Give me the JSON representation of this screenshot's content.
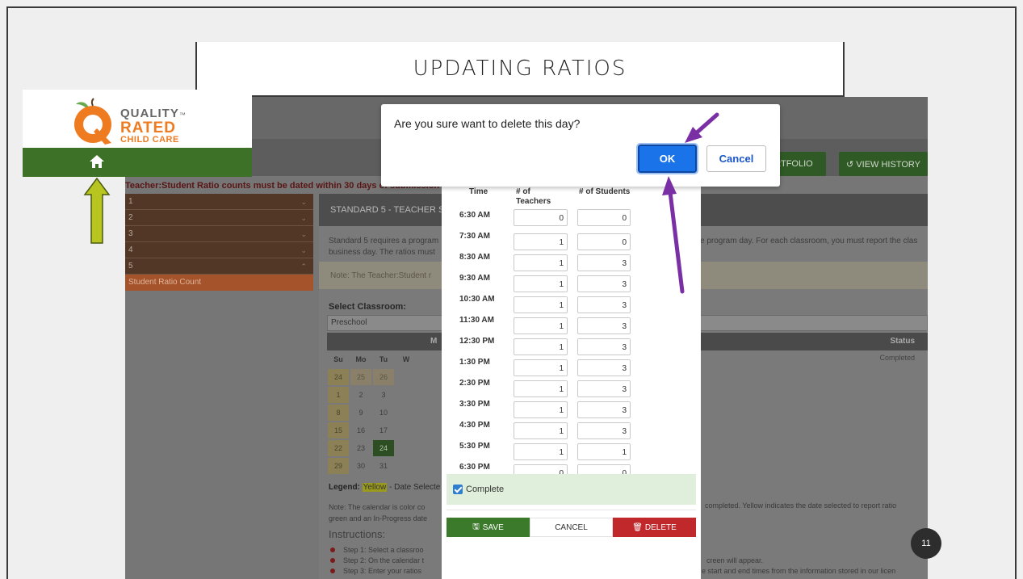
{
  "slide": {
    "title": "UPDATING RATIOS",
    "page_number": "11"
  },
  "logo": {
    "line1": "QUALITY",
    "tm": "™",
    "line2": "RATED",
    "line3": "CHILD CARE",
    "home_icon": "home-icon",
    "colors": {
      "orange": "#ef7b21",
      "green": "#3e7128"
    }
  },
  "background_app": {
    "header_buttons": [
      "RTFOLIO",
      "↺ VIEW HISTORY"
    ],
    "ratio_warning": "Teacher:Student Ratio counts must be dated within 30 days of submission of yo",
    "nav_items": [
      "1",
      "2",
      "3",
      "4",
      "5"
    ],
    "nav_sub_item": "Student Ratio Count",
    "standard_header": "STANDARD 5 - TEACHER S",
    "standard_text_left": "Standard 5 requires a program",
    "standard_text_left2": "business day. The ratios must",
    "standard_text_right": "e program day. For each classroom, you must report the clas",
    "note_text": "Note: The Teacher:Student r",
    "select_classroom_label": "Select Classroom:",
    "classroom_value": "Preschool",
    "calendar_month_initial": "M",
    "status_header": "Status",
    "status_value": "Completed",
    "calendar": {
      "weekdays": [
        "Su",
        "Mo",
        "Tu",
        "W"
      ],
      "rows": [
        [
          "24",
          "25",
          "26"
        ],
        [
          "1",
          "2",
          "3"
        ],
        [
          "8",
          "9",
          "10"
        ],
        [
          "15",
          "16",
          "17"
        ],
        [
          "22",
          "23",
          "24"
        ],
        [
          "29",
          "30",
          "31"
        ]
      ],
      "selected_date": "24"
    },
    "legend_label": "Legend:",
    "legend_yellow": "Yellow",
    "legend_rest": "- Date Selecte",
    "note2_left": "Note: The calendar is color co",
    "note2_left2": "green and an In-Progress date",
    "note2_right": "completed. Yellow indicates the date selected to report ratio",
    "instructions_title": "Instructions:",
    "steps": [
      "Step 1: Select a classroo",
      "Step 2: On the calendar t",
      "Step 3: Enter your ratios"
    ],
    "steps_right": [
      "creen will appear.",
      "e start and end times from the information stored in our licen"
    ]
  },
  "ratio_modal": {
    "col_time": "Time",
    "col_teachers_1": "# of",
    "col_teachers_2": "Teachers",
    "col_students": "# of Students",
    "rows": [
      {
        "time": "6:30 AM",
        "teachers": "0",
        "students": "0"
      },
      {
        "time": "7:30 AM",
        "teachers": "1",
        "students": "0"
      },
      {
        "time": "8:30 AM",
        "teachers": "1",
        "students": "3"
      },
      {
        "time": "9:30 AM",
        "teachers": "1",
        "students": "3"
      },
      {
        "time": "10:30 AM",
        "teachers": "1",
        "students": "3"
      },
      {
        "time": "11:30 AM",
        "teachers": "1",
        "students": "3"
      },
      {
        "time": "12:30 PM",
        "teachers": "1",
        "students": "3"
      },
      {
        "time": "1:30 PM",
        "teachers": "1",
        "students": "3"
      },
      {
        "time": "2:30 PM",
        "teachers": "1",
        "students": "3"
      },
      {
        "time": "3:30 PM",
        "teachers": "1",
        "students": "3"
      },
      {
        "time": "4:30 PM",
        "teachers": "1",
        "students": "3"
      },
      {
        "time": "5:30 PM",
        "teachers": "1",
        "students": "1"
      },
      {
        "time": "6:30 PM",
        "teachers": "0",
        "students": "0"
      }
    ],
    "complete_label": "Complete",
    "complete_checked": true,
    "save_label": "SAVE",
    "cancel_label": "CANCEL",
    "delete_label": "DELETE"
  },
  "confirm_dialog": {
    "message": "Are you sure want to delete this day?",
    "ok_label": "OK",
    "cancel_label": "Cancel"
  },
  "annotations": {
    "arrow_green_color": "#a8b619",
    "arrow_purple_color": "#7a2fa5"
  }
}
